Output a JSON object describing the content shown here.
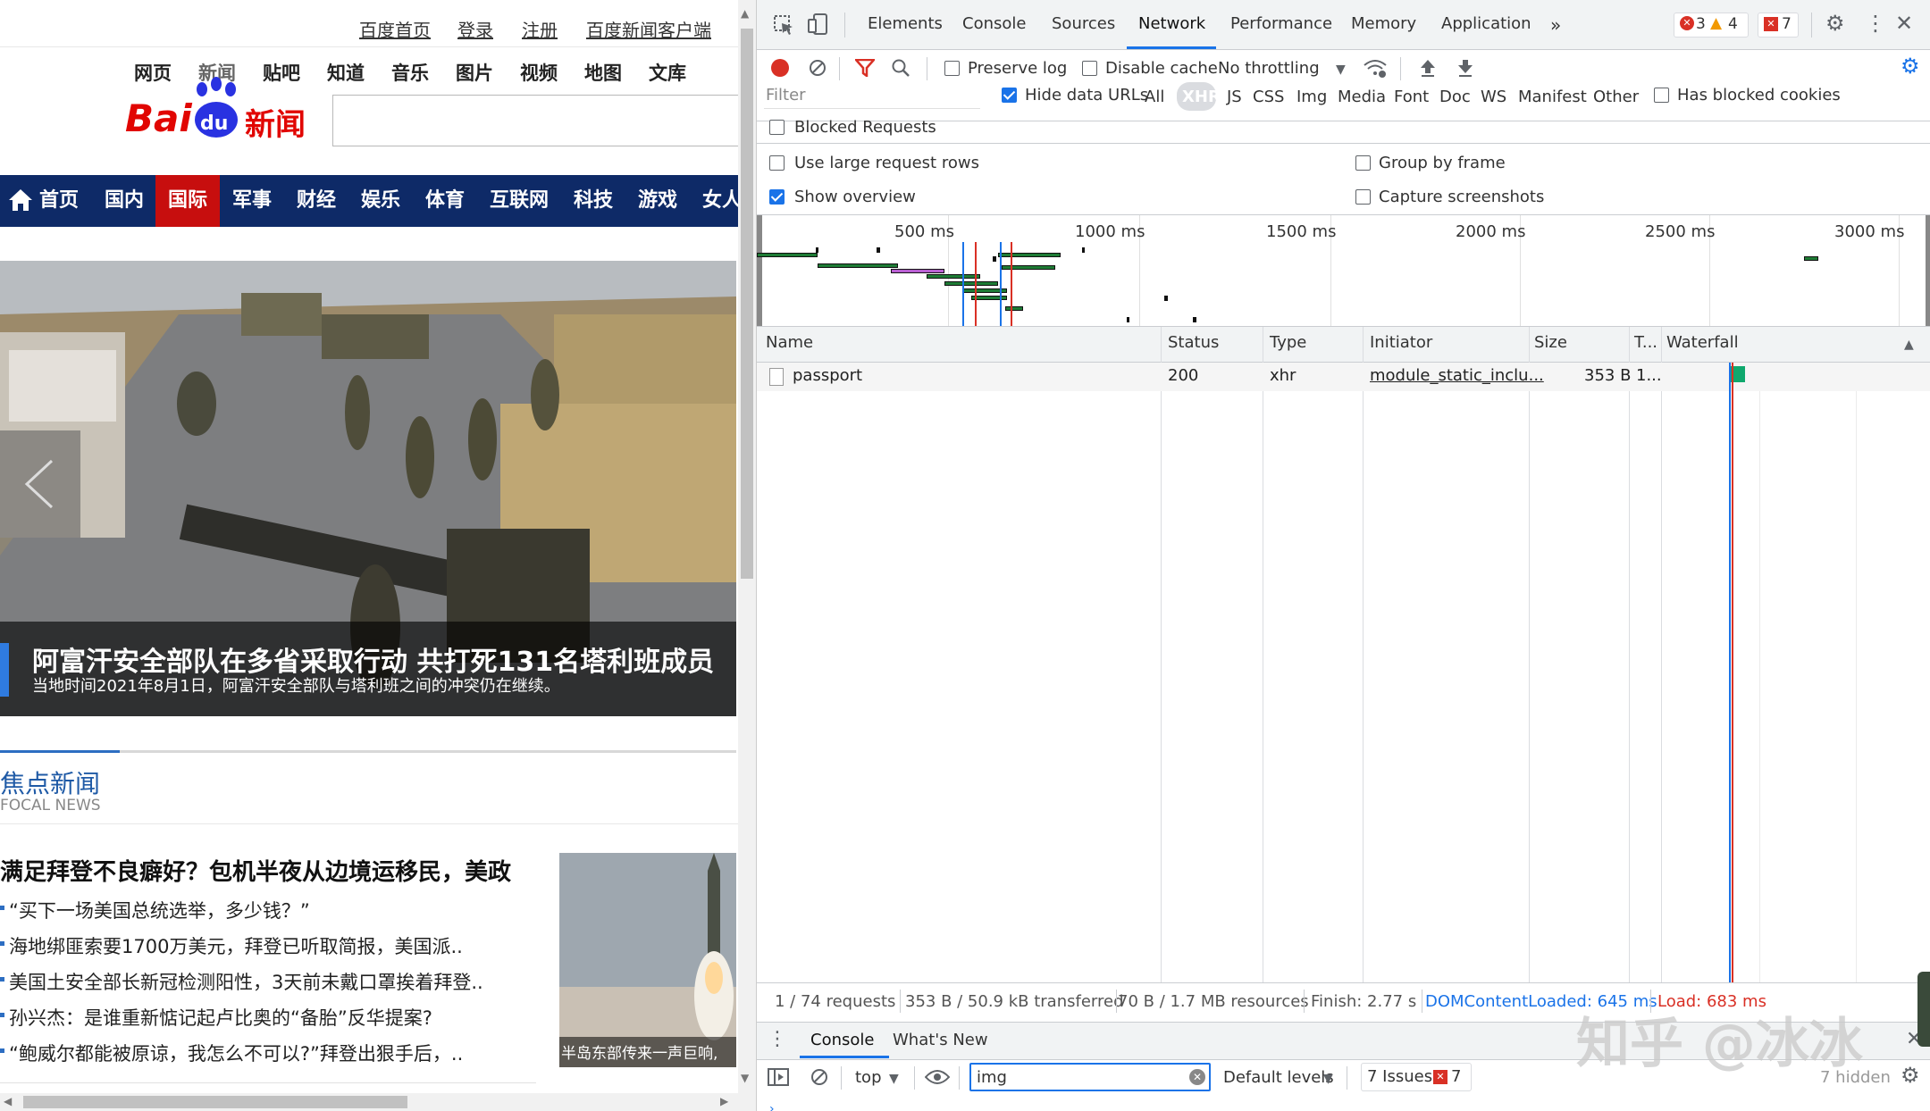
{
  "site": {
    "top_links": [
      "百度首页",
      "登录",
      "注册",
      "百度新闻客户端"
    ],
    "channels": [
      "网页",
      "新闻",
      "贴吧",
      "知道",
      "音乐",
      "图片",
      "视频",
      "地图",
      "文库"
    ],
    "logo_text": "Bai",
    "logo_suffix": "新闻",
    "logo_du": "du",
    "nav": [
      "首页",
      "国内",
      "国际",
      "军事",
      "财经",
      "娱乐",
      "体育",
      "互联网",
      "科技",
      "游戏",
      "女人"
    ],
    "nav_active": "国际",
    "hero_title": "阿富汗安全部队在多省采取行动 共打死131名塔利班成员",
    "hero_caption": "当地时间2021年8月1日，阿富汗安全部队与塔利班之间的冲突仍在继续。",
    "focus_title": "焦点新闻",
    "focus_sub": "FOCAL NEWS",
    "focus_headline": "满足拜登不良癖好？包机半夜从边境运移民，美政",
    "focus_items": [
      "“买下一场美国总统选举，多少钱？”",
      "海地绑匪索要1700万美元，拜登已听取简报，美国派..",
      "美国土安全部长新冠检测阳性，3天前未戴口罩挨着拜登..",
      "孙兴杰：是谁重新惦记起卢比奥的“备胎”反华提案?",
      "“鲍威尔都能被原谅，我怎么不可以?”拜登出狠手后，.."
    ],
    "photo_caption": "半岛东部传来一声巨响,"
  },
  "devtools": {
    "tabs": [
      "Elements",
      "Console",
      "Sources",
      "Network",
      "Performance",
      "Memory",
      "Application"
    ],
    "active_tab": "Network",
    "errors": "3",
    "warnings": "4",
    "issues_badge": "7",
    "toolbar": {
      "preserve_log": "Preserve log",
      "disable_cache": "Disable cache",
      "throttling": "No throttling"
    },
    "filter": {
      "placeholder": "Filter",
      "hide_data_urls": "Hide data URLs",
      "types": [
        "All",
        "XHR",
        "JS",
        "CSS",
        "Img",
        "Media",
        "Font",
        "Doc",
        "WS",
        "Manifest",
        "Other"
      ],
      "active_type": "XHR",
      "has_blocked_cookies": "Has blocked cookies",
      "blocked_requests": "Blocked Requests"
    },
    "settings": {
      "large_rows": "Use large request rows",
      "group_by_frame": "Group by frame",
      "show_overview": "Show overview",
      "capture_screenshots": "Capture screenshots"
    },
    "timeline_ticks": [
      "500 ms",
      "1000 ms",
      "1500 ms",
      "2000 ms",
      "2500 ms",
      "3000 ms"
    ],
    "table": {
      "headers": [
        "Name",
        "Status",
        "Type",
        "Initiator",
        "Size",
        "T...",
        "Waterfall"
      ],
      "rows": [
        {
          "name": "passport",
          "status": "200",
          "type": "xhr",
          "initiator": "module_static_inclu...",
          "size": "353 B",
          "time": "1..."
        }
      ]
    },
    "summary": {
      "requests": "1 / 74 requests",
      "transferred": "353 B / 50.9 kB transferred",
      "resources": "70 B / 1.7 MB resources",
      "finish": "Finish: 2.77 s",
      "dcl": "DOMContentLoaded: 645 ms",
      "load": "Load: 683 ms"
    },
    "drawer": {
      "tabs": [
        "Console",
        "What's New"
      ],
      "context": "top",
      "filter_value": "img",
      "levels": "Default levels",
      "issues_label": "7 Issues:",
      "issues_count": "7",
      "hidden": "7 hidden"
    }
  },
  "watermark": "知乎 @冰冰",
  "colors": {
    "nav_bg": "#0e2a67",
    "nav_active": "#c70e0e",
    "accent": "#1a73e8",
    "record": "#d93025"
  }
}
